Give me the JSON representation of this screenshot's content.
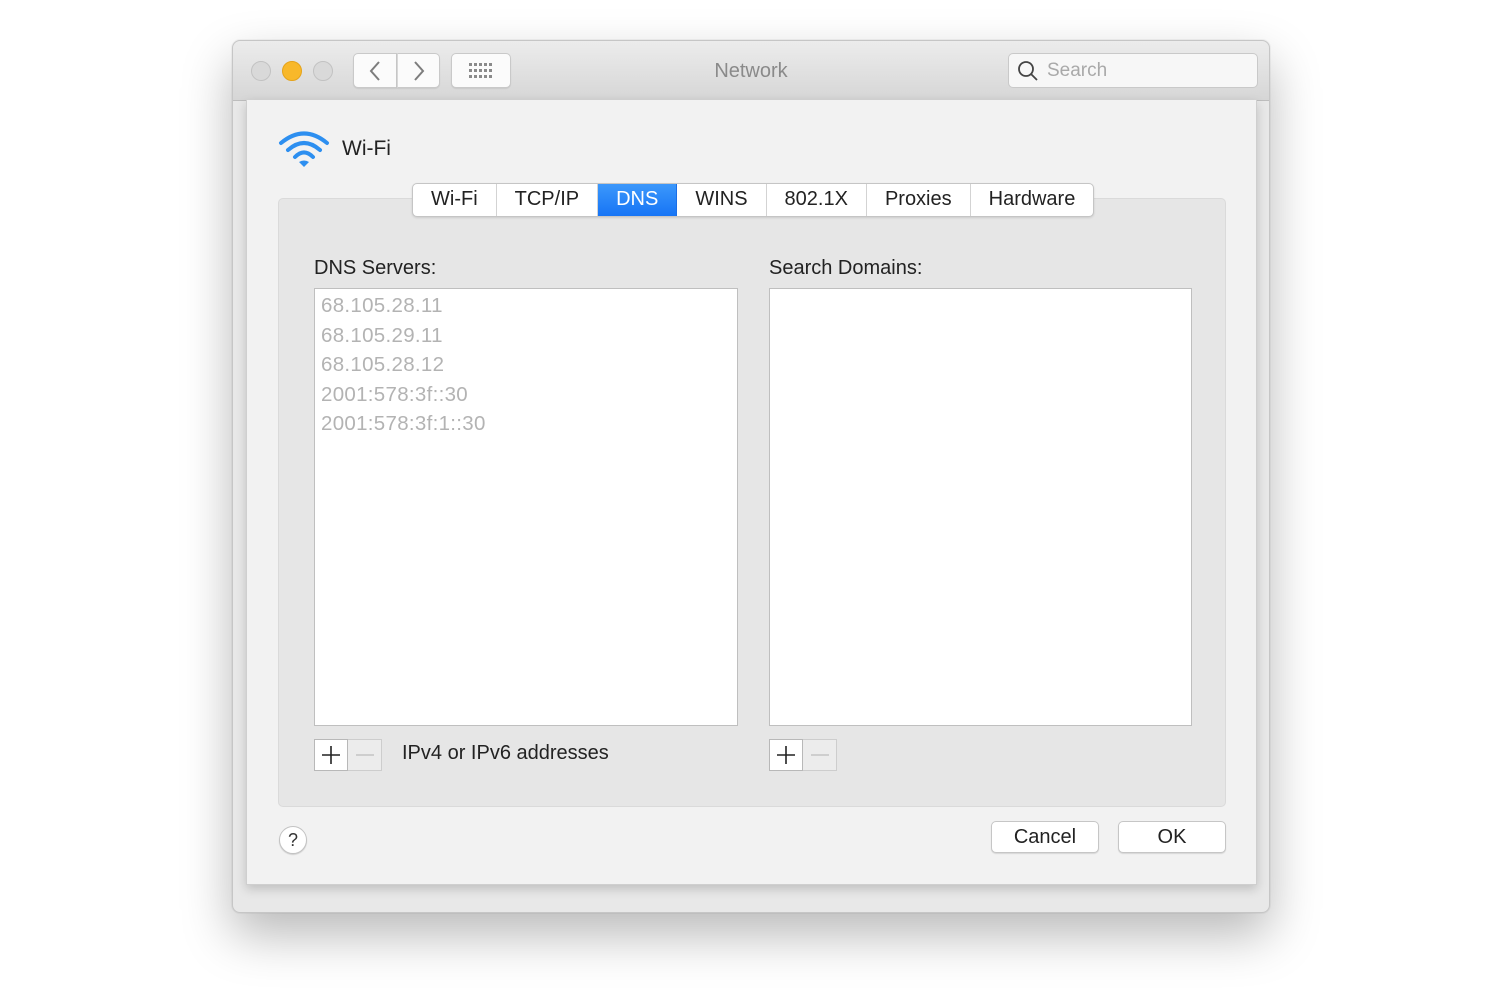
{
  "window": {
    "title": "Network",
    "search": {
      "placeholder": "Search",
      "value": ""
    },
    "traffic_lights": [
      "close",
      "minimize",
      "zoom"
    ],
    "nav": {
      "back_icon": "chevron-left-icon",
      "forward_icon": "chevron-right-icon",
      "grid_icon": "show-all-grid-icon"
    }
  },
  "sheet": {
    "interface_name": "Wi-Fi",
    "interface_icon": "wifi-icon",
    "tabs": [
      {
        "label": "Wi-Fi",
        "active": false
      },
      {
        "label": "TCP/IP",
        "active": false
      },
      {
        "label": "DNS",
        "active": true
      },
      {
        "label": "WINS",
        "active": false
      },
      {
        "label": "802.1X",
        "active": false
      },
      {
        "label": "Proxies",
        "active": false
      },
      {
        "label": "Hardware",
        "active": false
      }
    ],
    "dns_servers": {
      "label": "DNS Servers:",
      "entries": [
        "68.105.28.11",
        "68.105.29.11",
        "68.105.28.12",
        "2001:578:3f::30",
        "2001:578:3f:1::30"
      ],
      "hint": "IPv4 or IPv6 addresses"
    },
    "search_domains": {
      "label": "Search Domains:",
      "entries": []
    },
    "buttons": {
      "help": "?",
      "cancel": "Cancel",
      "ok": "OK"
    },
    "colors": {
      "accent": "#1e7cf7",
      "traffic_minimize": "#f8b82a",
      "wifi": "#2d8ff0"
    }
  }
}
